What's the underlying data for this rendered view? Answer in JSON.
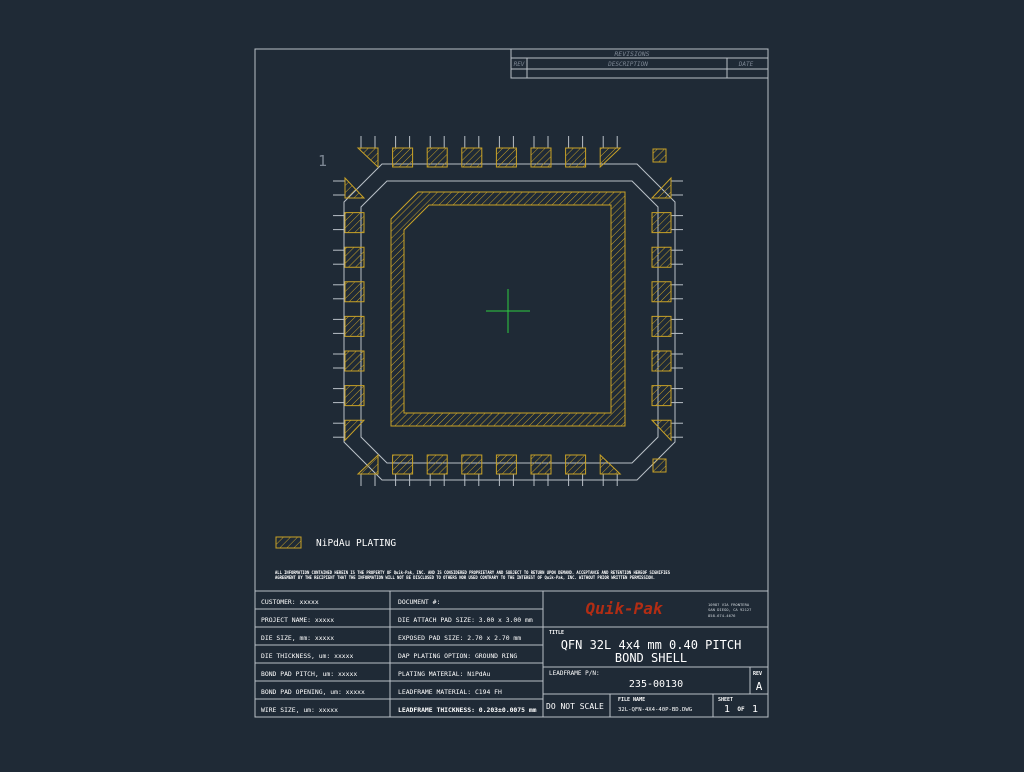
{
  "revisions": {
    "header": "REVISIONS",
    "col_rev": "REV",
    "col_description": "DESCRIPTION",
    "col_date": "DATE"
  },
  "drawing": {
    "pin_one_label": "1",
    "legend_label": "NiPdAu PLATING",
    "disclaimer_line1": "ALL INFORMATION CONTAINED HEREIN IS THE PROPERTY OF Quik-Pak, INC. AND IS CONSIDERED PROPRIETARY AND SUBJECT TO RETURN UPON DEMAND. ACCEPTANCE AND RETENTION HEREOF SIGNIFIES",
    "disclaimer_line2": "AGREEMENT BY THE RECIPIENT THAT THE INFORMATION WILL NOT BE DISCLOSED TO OTHERS NOR USED CONTRARY TO THE INTEREST OF Quik-Pak, INC. WITHOUT PRIOR WRITTEN PERMISSION."
  },
  "title_block": {
    "left_fields": [
      "CUSTOMER:  xxxxx",
      "PROJECT NAME: xxxxx",
      "DIE SIZE, mm: xxxxx",
      "DIE THICKNESS, um: xxxxx",
      "BOND PAD PITCH, um: xxxxx",
      "BOND PAD OPENING, um:  xxxxx",
      "WIRE SIZE, um:  xxxxx"
    ],
    "middle_fields": [
      "DOCUMENT #:",
      "DIE ATTACH PAD SIZE:  3.00 x 3.00 mm",
      "EXPOSED PAD SIZE:  2.70 x 2.70 mm",
      "DAP PLATING OPTION:  GROUND RING",
      "PLATING MATERIAL:  NiPdAu",
      "LEADFRAME MATERIAL:  C194 FH",
      "LEADFRAME THICKNESS: 0.203±0.0075 mm"
    ],
    "company_logo": "Quik-Pak",
    "address": [
      "10987 VIA FRONTERA",
      "SAN DIEGO, CA 92127",
      "858-674-4676"
    ],
    "title_label": "TITLE",
    "title_line1": "QFN 32L 4x4 mm 0.40 PITCH",
    "title_line2": "BOND SHELL",
    "pn_label": "LEADFRAME P/N:",
    "pn_value": "235-00130",
    "rev_label": "REV",
    "rev_value": "A",
    "do_not_scale": "DO NOT SCALE",
    "file_label": "FILE NAME",
    "file_value": "32L-QFN-4X4-40P-BD.DWG",
    "sheet_label": "SHEET",
    "sheet_num": "1",
    "sheet_of": "OF",
    "sheet_total": "1"
  },
  "colors": {
    "background": "#1f2a36",
    "frame_line": "#b9c0c7",
    "plating": "#c9a227",
    "center_mark": "#2ecc40",
    "logo": "#b22d14"
  }
}
